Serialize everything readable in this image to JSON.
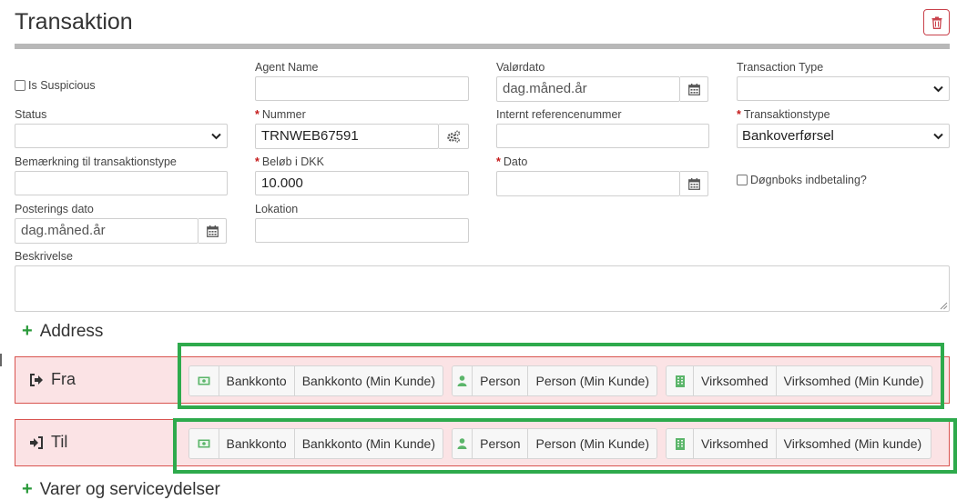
{
  "title": "Transaktion",
  "colors": {
    "accent_green": "#2eaa4c",
    "danger": "#c9414b",
    "party_bg": "#fbe3e5"
  },
  "form": {
    "is_suspicious": {
      "label": "Is Suspicious"
    },
    "agent_name": {
      "label": "Agent Name",
      "value": ""
    },
    "valordato": {
      "label": "Valørdato",
      "placeholder": "dag.måned.år"
    },
    "transaction_type": {
      "label": "Transaction Type",
      "value": ""
    },
    "status": {
      "label": "Status",
      "value": ""
    },
    "nummer": {
      "label": "Nummer",
      "value": "TRNWEB67591"
    },
    "internt_ref": {
      "label": "Internt referencenummer",
      "value": ""
    },
    "transaktionstype": {
      "label": "Transaktionstype",
      "value": "Bankoverførsel"
    },
    "bemaerkning": {
      "label": "Bemærkning til transaktionstype",
      "value": ""
    },
    "beloeb": {
      "label": "Beløb i DKK",
      "value": "10.000"
    },
    "dato": {
      "label": "Dato",
      "value": ""
    },
    "doegnboks": {
      "label": "Døgnboks indbetaling?"
    },
    "posterings_dato": {
      "label": "Posterings dato",
      "placeholder": "dag.måned.år"
    },
    "lokation": {
      "label": "Lokation",
      "value": ""
    },
    "beskrivelse": {
      "label": "Beskrivelse",
      "value": ""
    }
  },
  "sections": {
    "address": "Address",
    "varer": "Varer og serviceydelser"
  },
  "fra": {
    "label": "Fra",
    "buttons": [
      "Bankkonto",
      "Bankkonto (Min Kunde)",
      "Person",
      "Person (Min Kunde)",
      "Virksomhed",
      "Virksomhed (Min Kunde)"
    ]
  },
  "til": {
    "label": "Til",
    "buttons": [
      "Bankkonto",
      "Bankkonto (Min Kunde)",
      "Person",
      "Person (Min Kunde)",
      "Virksomhed",
      "Virksomhed (Min kunde)"
    ]
  },
  "icons": [
    "trash-icon",
    "calendar-icon",
    "chevron-down-icon",
    "gears-icon",
    "plus-icon",
    "sign-out-icon",
    "sign-in-icon",
    "money-icon",
    "user-icon",
    "building-icon"
  ]
}
